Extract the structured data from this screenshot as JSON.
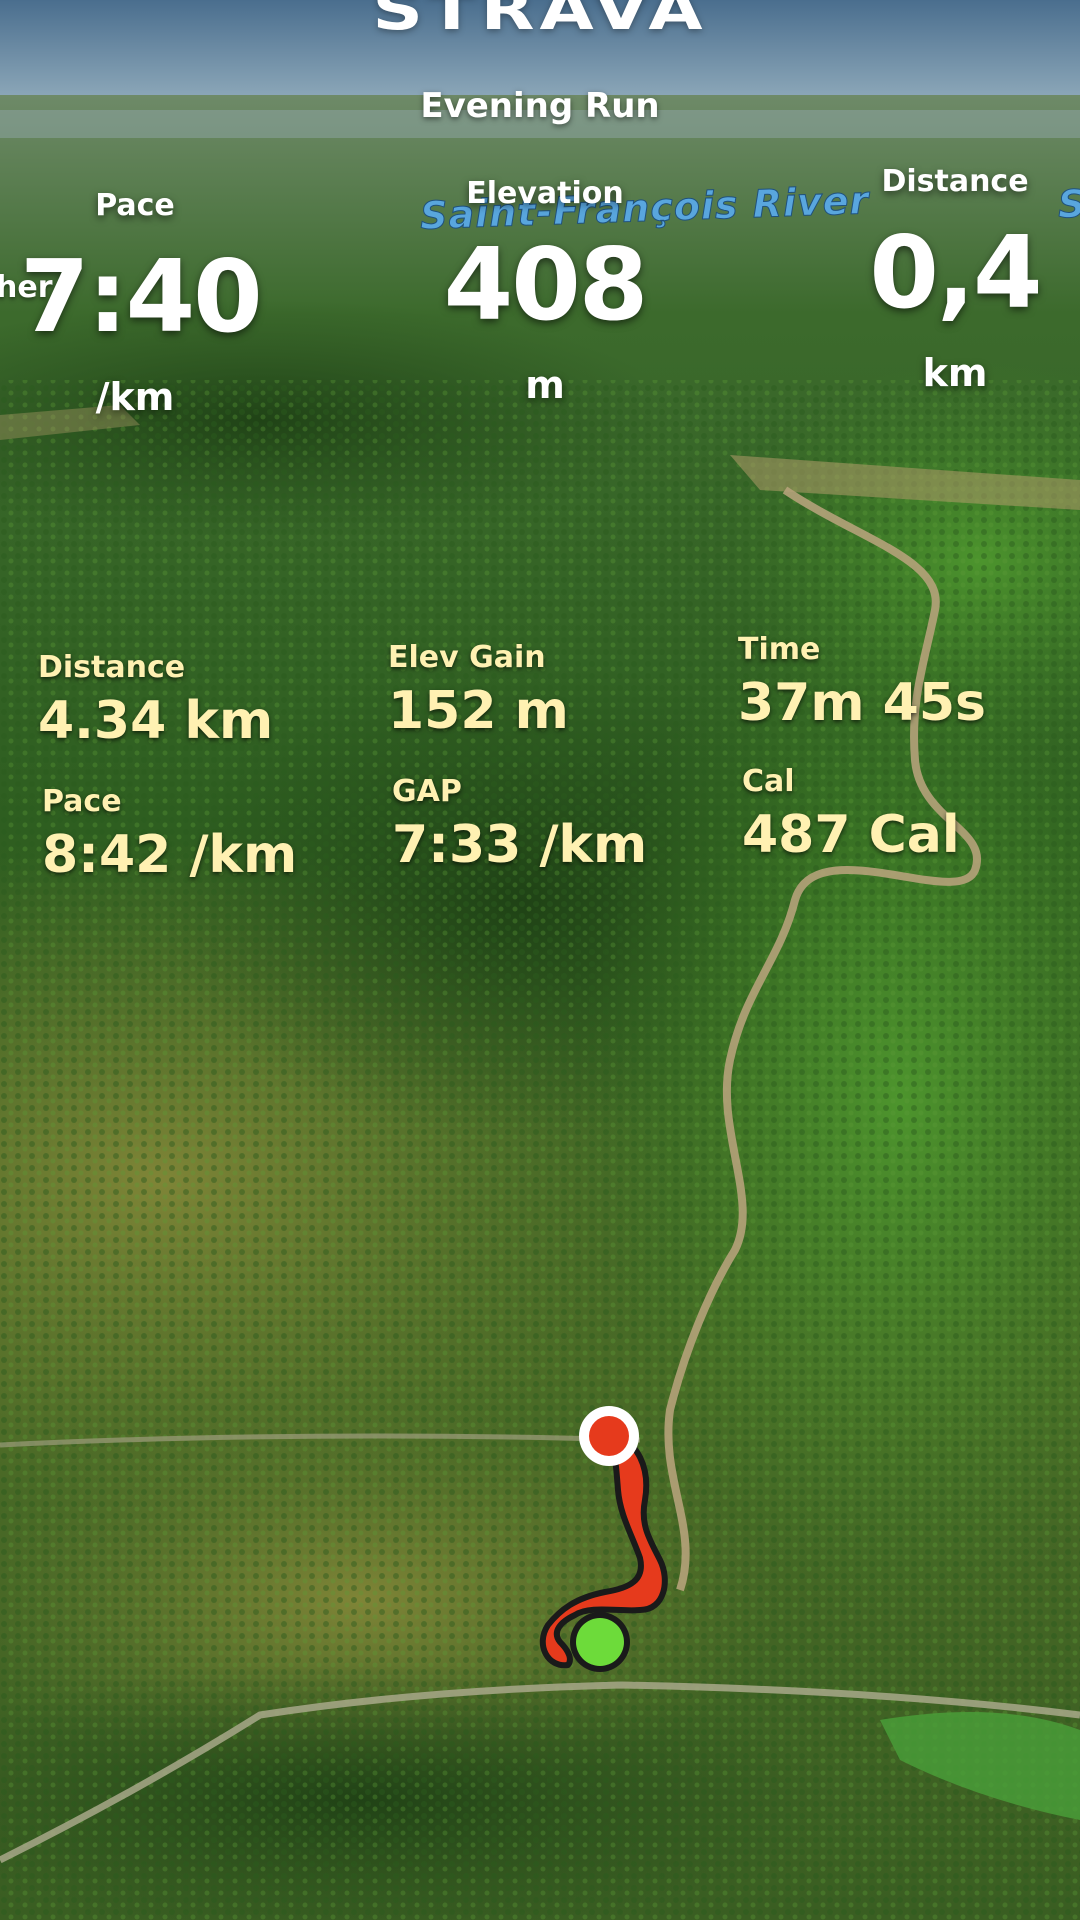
{
  "header": {
    "brand": "STRAVA",
    "activity_title": "Evening Run"
  },
  "map": {
    "river_label": "Saint-François River",
    "river_label_partial": "S",
    "edge_text": "her",
    "start_marker_color": "#6ddb3a",
    "end_marker_color": "#e63a1c",
    "route_color": "#e63a1c"
  },
  "live_stats": [
    {
      "label": "Pace",
      "value": "7:40",
      "unit": "/km"
    },
    {
      "label": "Elevation",
      "value": "408",
      "unit": "m"
    },
    {
      "label": "Distance",
      "value": "0,4",
      "unit": "km"
    }
  ],
  "summary_stats": [
    {
      "label": "Distance",
      "value": "4.34 km"
    },
    {
      "label": "Elev Gain",
      "value": "152 m"
    },
    {
      "label": "Time",
      "value": "37m 45s"
    },
    {
      "label": "Pace",
      "value": "8:42 /km"
    },
    {
      "label": "GAP",
      "value": "7:33 /km"
    },
    {
      "label": "Cal",
      "value": "487 Cal"
    }
  ],
  "colors": {
    "stat_text": "#fff1b2",
    "river_text": "#5aa9e6"
  }
}
